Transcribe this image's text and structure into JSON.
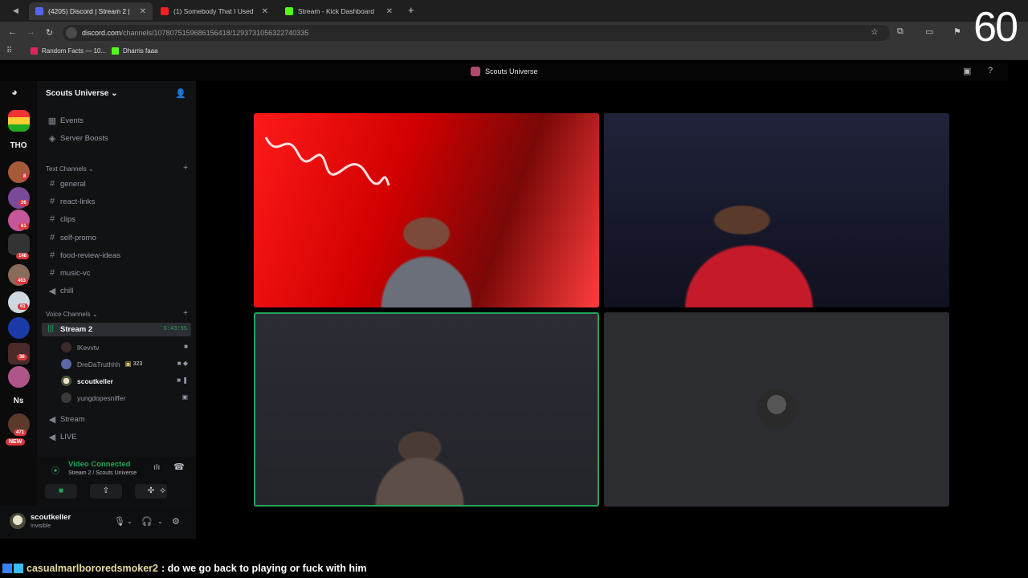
{
  "browser": {
    "tabs": [
      {
        "title": "(4205) Discord | Stream 2 |",
        "active": true
      },
      {
        "title": "(1) Somebody That I Used",
        "active": false
      },
      {
        "title": "Stream - Kick Dashboard",
        "active": false
      }
    ],
    "url_host": "discord.com",
    "url_path": "/channels/1078075159686156418/1293731056322740335",
    "bookmarks": [
      "Random Facts — 10...",
      "Dharris faaa"
    ],
    "overlay_counter": "60"
  },
  "discord": {
    "window_title": "Scouts Universe",
    "server_rail": {
      "labels": [
        "THO",
        "Ns"
      ],
      "badges": [
        "8",
        "26",
        "61",
        "148",
        "463",
        "61",
        "36",
        "471"
      ],
      "new_label": "NEW"
    },
    "server_name": "Scouts Universe",
    "top_items": [
      "Events",
      "Server Boosts"
    ],
    "text_category": "Text Channels",
    "text_channels": [
      "general",
      "react-links",
      "clips",
      "self-promo",
      "food-review-ideas",
      "music-vc",
      "chill"
    ],
    "voice_category": "Voice Channels",
    "active_voice": {
      "name": "Stream 2",
      "timer": "5:43:55"
    },
    "voice_users": [
      {
        "name": "lKevvtv"
      },
      {
        "name": "DreDaTruthhh",
        "tag": "323"
      },
      {
        "name": "scoutkeller"
      },
      {
        "name": "yungdopesniffer"
      }
    ],
    "other_voice": [
      "Stream",
      "LIVE"
    ],
    "connection": {
      "status": "Video Connected",
      "channel": "Stream 2 / Scouts Universe"
    },
    "user": {
      "name": "scoutkeller",
      "status": "Invisible"
    }
  },
  "chat": {
    "user": "casualmarlbororedsmoker2",
    "message": ": do we go back to playing or fuck with him"
  },
  "colors": {
    "accent_green": "#23a55a",
    "badge_red": "#da373c",
    "chat_name": "#e8d9a0"
  }
}
